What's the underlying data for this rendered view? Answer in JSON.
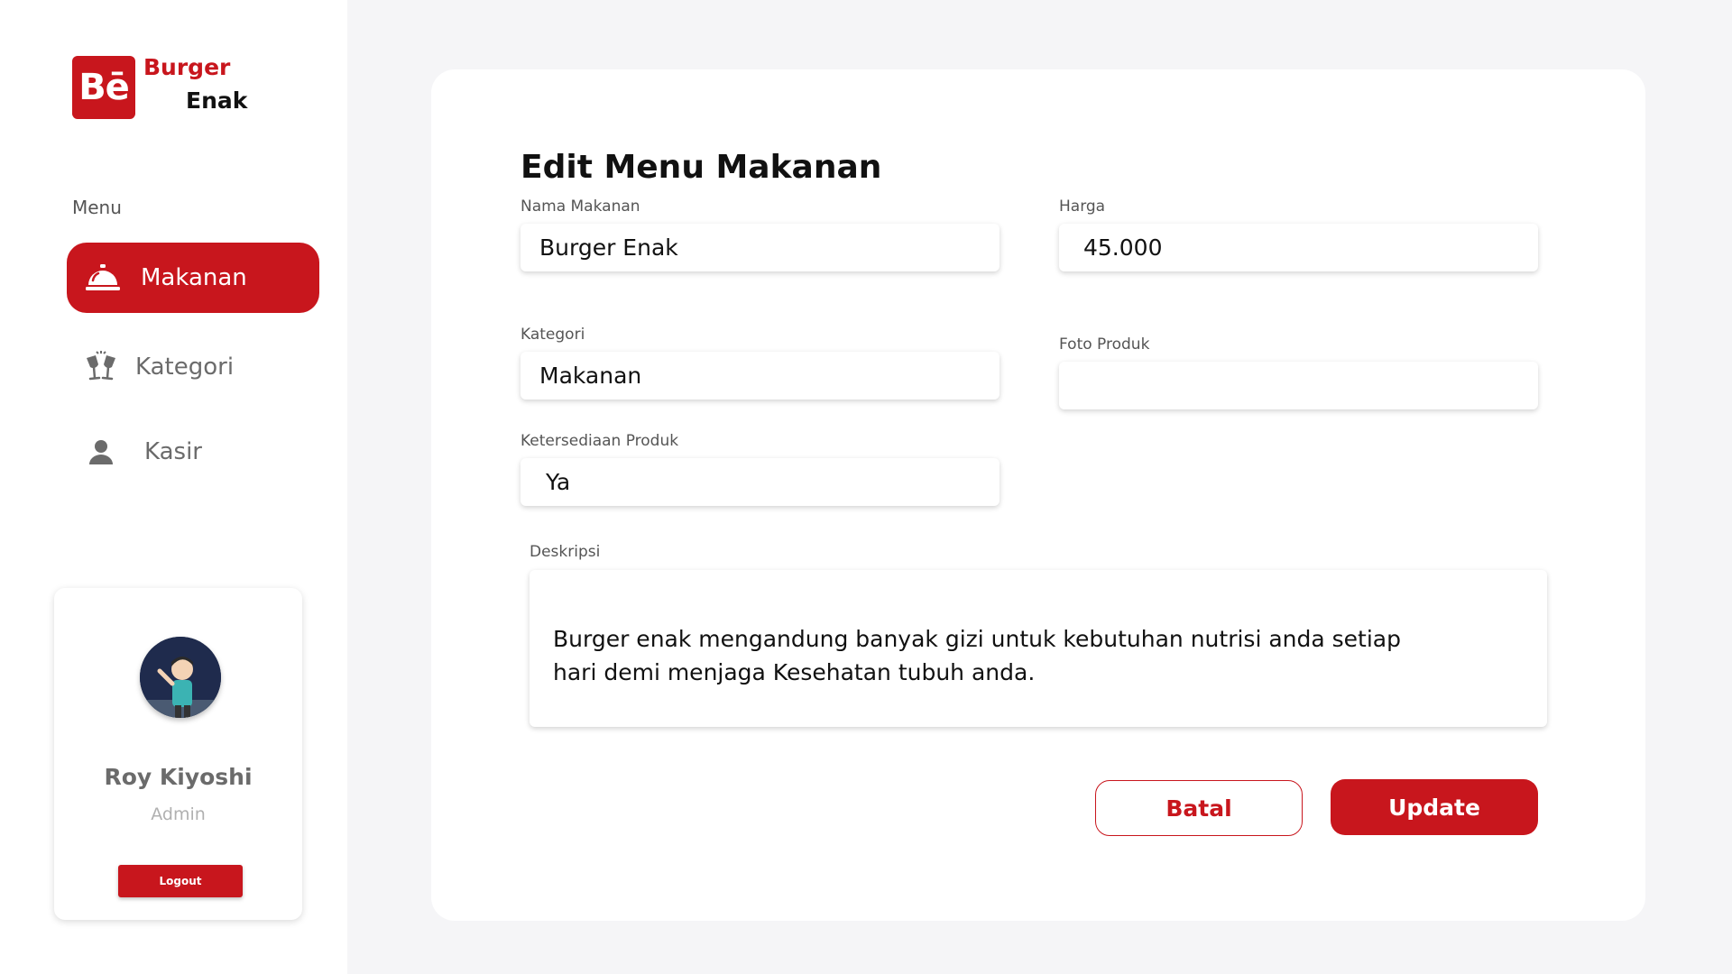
{
  "brand": {
    "badge": "Bē",
    "line1": "Burger",
    "line2": "Enak",
    "accent_color": "#c8161d"
  },
  "sidebar": {
    "menu_heading": "Menu",
    "items": [
      {
        "label": "Makanan",
        "icon": "service-bell-icon",
        "active": true
      },
      {
        "label": "Kategori",
        "icon": "cheers-glasses-icon",
        "active": false
      },
      {
        "label": "Kasir",
        "icon": "user-icon",
        "active": false
      }
    ]
  },
  "profile": {
    "name": "Roy Kiyoshi",
    "role": "Admin",
    "logout_label": "Logout",
    "avatar_icon": "avatar-person-icon"
  },
  "form": {
    "title": "Edit Menu Makanan",
    "nama_label": "Nama Makanan",
    "nama_value": "Burger Enak",
    "harga_label": "Harga",
    "harga_value": "45.000",
    "kategori_label": "Kategori",
    "kategori_value": "Makanan",
    "foto_label": "Foto Produk",
    "foto_value": "",
    "ketersediaan_label": "Ketersediaan Produk",
    "ketersediaan_value": "Ya",
    "deskripsi_label": "Deskripsi",
    "deskripsi_value": "Burger enak mengandung banyak gizi untuk kebutuhan nutrisi anda setiap hari demi menjaga Kesehatan tubuh anda.",
    "batal_label": "Batal",
    "update_label": "Update"
  }
}
